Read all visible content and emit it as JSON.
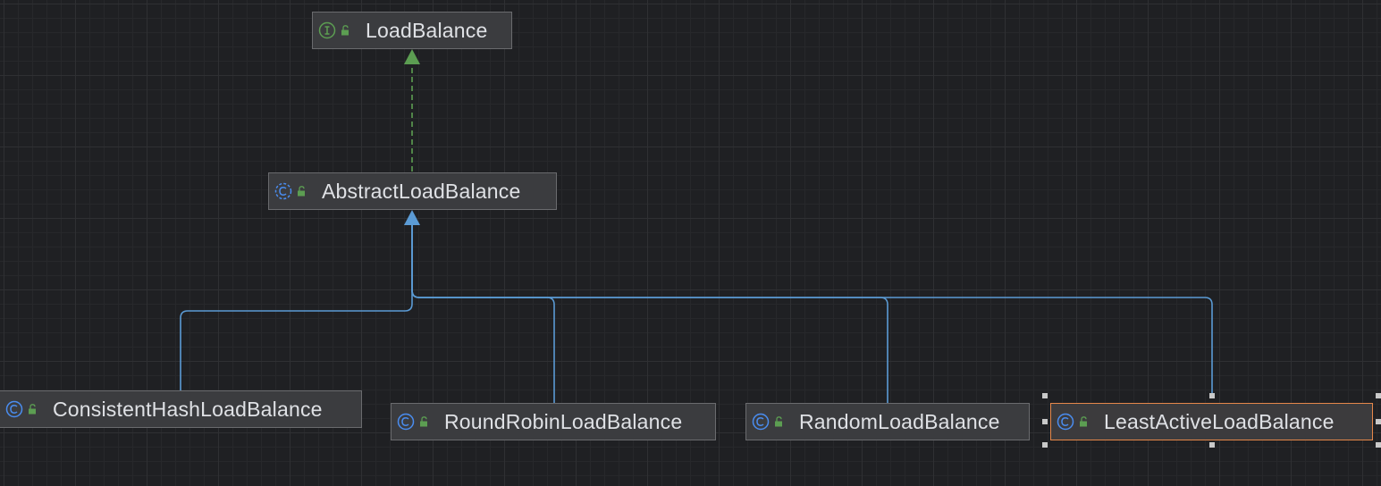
{
  "diagram": {
    "nodes": [
      {
        "id": "load-balance",
        "label": "LoadBalance",
        "kind": "interface",
        "visibility": "public"
      },
      {
        "id": "abstract-load-balance",
        "label": "AbstractLoadBalance",
        "kind": "abstract-class",
        "visibility": "public"
      },
      {
        "id": "consistent-hash-load-balance",
        "label": "ConsistentHashLoadBalance",
        "kind": "class",
        "visibility": "public"
      },
      {
        "id": "round-robin-load-balance",
        "label": "RoundRobinLoadBalance",
        "kind": "class",
        "visibility": "public"
      },
      {
        "id": "random-load-balance",
        "label": "RandomLoadBalance",
        "kind": "class",
        "visibility": "public"
      },
      {
        "id": "least-active-load-balance",
        "label": "LeastActiveLoadBalance",
        "kind": "class",
        "visibility": "public",
        "selected": true
      }
    ],
    "edges": [
      {
        "from": "abstract-load-balance",
        "to": "load-balance",
        "type": "implements"
      },
      {
        "from": "consistent-hash-load-balance",
        "to": "abstract-load-balance",
        "type": "extends"
      },
      {
        "from": "round-robin-load-balance",
        "to": "abstract-load-balance",
        "type": "extends"
      },
      {
        "from": "random-load-balance",
        "to": "abstract-load-balance",
        "type": "extends"
      },
      {
        "from": "least-active-load-balance",
        "to": "abstract-load-balance",
        "type": "extends"
      }
    ],
    "colors": {
      "canvas": "#1f2023",
      "node_fill": "#3b3c3f",
      "node_border": "#6a6b6e",
      "selected_border": "#e5874a",
      "extends_edge": "#5b9bd5",
      "implements_edge": "#5c9e52",
      "interface_icon": "#5c9e52",
      "class_icon": "#4a8df0",
      "lock_icon": "#5c9e52",
      "text": "#dfe1e5"
    }
  }
}
